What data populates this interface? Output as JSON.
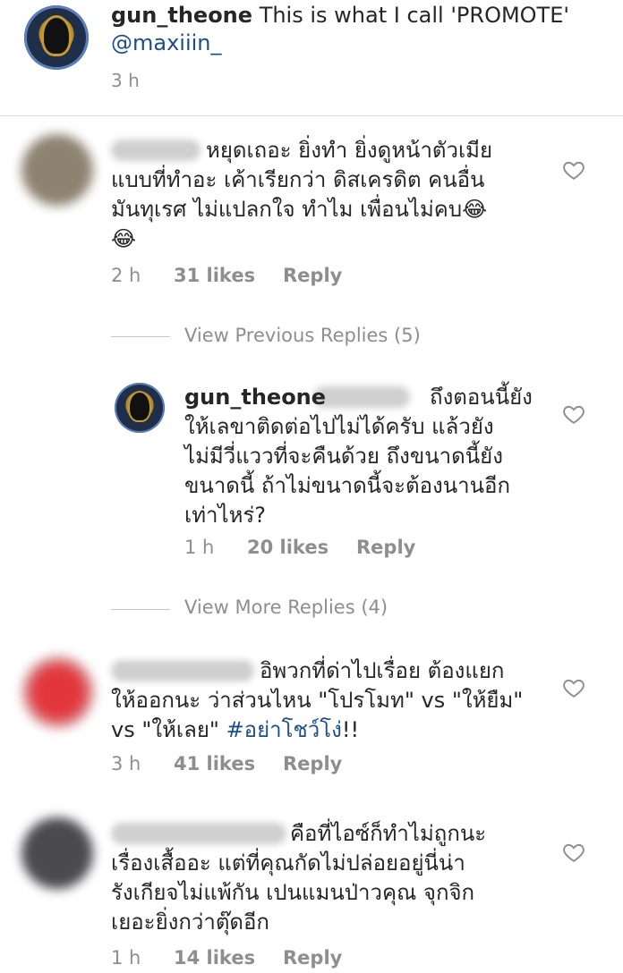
{
  "post": {
    "username": "gun_theone",
    "caption": "This is what I call 'PROMOTE'",
    "mention": "@maxiiin_",
    "time": "3 h"
  },
  "comments": [
    {
      "line1": "หยุดเถอะ ยิ่งทำ ยิ่งดูหน้าตัวเมีย",
      "line2": "แบบที่ทำอะ เค้าเรียกว่า ดิสเครดิต คนอื่น",
      "line3": "มันทุเรศ ไม่แปลกใจ ทำไม เพื่อนไม่คบ😂",
      "line4": "😂",
      "time": "2 h",
      "likes": "31 likes",
      "reply": "Reply"
    },
    {
      "line1": "อิพวกที่ด่าไปเรื่อย ต้องแยก",
      "line2": "ให้ออกนะ ว่าส่วนไหน \"โปรโมท\" vs \"ให้ยืม\"",
      "line3_pre": "vs \"ให้เลย\" ",
      "hashtag": "#อย่าโชว์โง่",
      "line3_post": "!!",
      "time": "3 h",
      "likes": "41 likes",
      "reply": "Reply"
    },
    {
      "line1": "คือที่ไอซ์ก็ทำไม่ถูกนะ",
      "line2": "เรื่องเสื้ออะ  แต่ที่คุณกัดไม่ปล่อยอยู่นี่น่า",
      "line3": "รังเกียจไม่แพ้กัน เปนแมนป่าวคุณ จุกจิก",
      "line4": "เยอะยิ่งกว่าตุ๊ดอีก",
      "time": "1 h",
      "likes": "14 likes",
      "reply": "Reply"
    }
  ],
  "view_previous": "View Previous Replies (5)",
  "view_more": "View More Replies (4)",
  "reply": {
    "username": "gun_theone",
    "line1": "ถึงตอนนี้ยัง",
    "line2": "ให้เลขาติดต่อไปไม่ได้ครับ แล้วยัง",
    "line3": "ไม่มีวี่แววที่จะคืนด้วย ถึงขนาดนี้ยัง",
    "line4": "ขนาดนี้ ถ้าไม่ขนาดนี้จะต้องนานอีก",
    "line5": "เท่าไหร่?",
    "time": "1 h",
    "likes": "20 likes",
    "reply_label": "Reply"
  },
  "colors": {
    "text": "#262626",
    "muted": "#8e8e8e",
    "link": "#1d4e89",
    "divider": "#dbdbdb"
  },
  "icons": {
    "like": "heart-outline-icon"
  }
}
